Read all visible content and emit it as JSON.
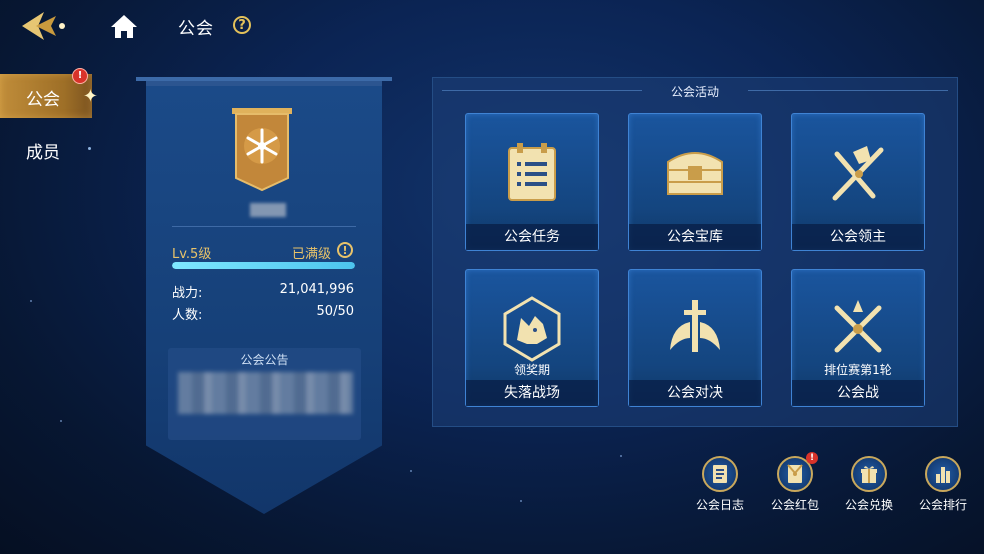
{
  "header": {
    "title": "公会",
    "help_glyph": "?"
  },
  "tabs": [
    {
      "label": "公会",
      "badge": "!",
      "active": true
    },
    {
      "label": "成员",
      "active": false
    }
  ],
  "guild": {
    "level_label": "Lv.5级",
    "max_label": "已满级",
    "max_icon_glyph": "!",
    "xp_progress": 1.0,
    "power_label": "战力:",
    "power_value": "21,041,996",
    "members_label": "人数:",
    "members_value": "50/50",
    "notice_title": "公会公告"
  },
  "activities": {
    "title": "公会活动",
    "cards": [
      {
        "label": "公会任务",
        "icon": "task-board-icon"
      },
      {
        "label": "公会宝库",
        "icon": "treasure-chest-icon"
      },
      {
        "label": "公会领主",
        "icon": "crossed-swords-icon"
      },
      {
        "label": "失落战场",
        "sub": "领奖期",
        "icon": "wolf-emblem-icon"
      },
      {
        "label": "公会对决",
        "icon": "sword-wings-icon"
      },
      {
        "label": "公会战",
        "sub": "排位赛第1轮",
        "icon": "battle-swords-icon"
      }
    ]
  },
  "shortcuts": [
    {
      "label": "公会日志",
      "icon": "log-book-icon"
    },
    {
      "label": "公会红包",
      "icon": "red-envelope-icon",
      "badge": "!"
    },
    {
      "label": "公会兑换",
      "icon": "gift-box-icon"
    },
    {
      "label": "公会排行",
      "icon": "ranking-bars-icon"
    }
  ],
  "colors": {
    "gold": "#e8c36a",
    "card_border": "#3f83d4",
    "xp_fill": "#4cc4ee",
    "badge_red": "#d8332a"
  }
}
